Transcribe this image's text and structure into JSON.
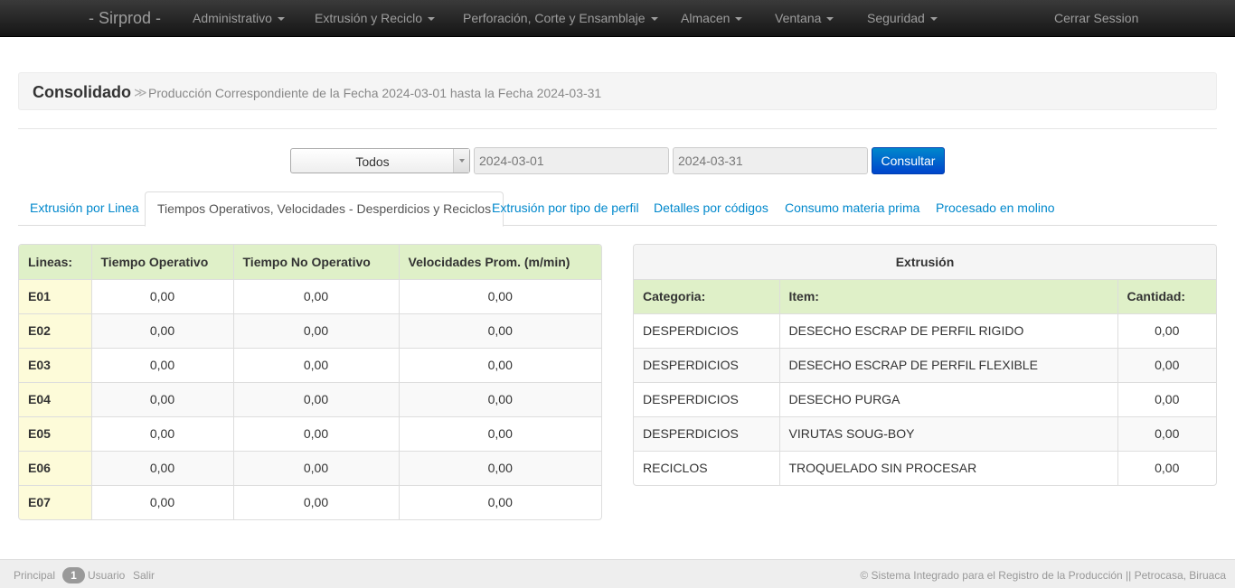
{
  "navbar": {
    "brand": "- Sirprod -",
    "menus": [
      "Administrativo",
      "Extrusión y Reciclo",
      "Perforación, Corte y Ensamblaje",
      "Almacen",
      "Ventana",
      "Seguridad"
    ],
    "logout": "Cerrar Session"
  },
  "breadcrumb": {
    "title": "Consolidado",
    "separator": "≫",
    "subtitle": "Producción Correspondiente de la Fecha 2024-03-01 hasta la Fecha 2024-03-31"
  },
  "filter": {
    "select_value": "Todos",
    "date_from": "2024-03-01",
    "date_to": "2024-03-31",
    "submit_label": "Consultar"
  },
  "tabs": [
    "Extrusión por Linea",
    "Tiempos Operativos, Velocidades - Desperdicios y Reciclos",
    "Extrusión por tipo de perfil",
    "Detalles por códigos",
    "Consumo materia prima",
    "Procesado en molino"
  ],
  "active_tab": 1,
  "lines_table": {
    "headers": [
      "Lineas:",
      "Tiempo Operativo",
      "Tiempo No Operativo",
      "Velocidades Prom. (m/min)"
    ],
    "rows": [
      [
        "E01",
        "0,00",
        "0,00",
        "0,00"
      ],
      [
        "E02",
        "0,00",
        "0,00",
        "0,00"
      ],
      [
        "E03",
        "0,00",
        "0,00",
        "0,00"
      ],
      [
        "E04",
        "0,00",
        "0,00",
        "0,00"
      ],
      [
        "E05",
        "0,00",
        "0,00",
        "0,00"
      ],
      [
        "E06",
        "0,00",
        "0,00",
        "0,00"
      ],
      [
        "E07",
        "0,00",
        "0,00",
        "0,00"
      ]
    ]
  },
  "extrusion_table": {
    "caption": "Extrusión",
    "headers": [
      "Categoria:",
      "Item:",
      "Cantidad:"
    ],
    "rows": [
      [
        "DESPERDICIOS",
        "DESECHO ESCRAP DE PERFIL RIGIDO",
        "0,00"
      ],
      [
        "DESPERDICIOS",
        "DESECHO ESCRAP DE PERFIL FLEXIBLE",
        "0,00"
      ],
      [
        "DESPERDICIOS",
        "DESECHO PURGA",
        "0,00"
      ],
      [
        "DESPERDICIOS",
        "VIRUTAS SOUG-BOY",
        "0,00"
      ],
      [
        "RECICLOS",
        "TROQUELADO SIN PROCESAR",
        "0,00"
      ]
    ]
  },
  "footer": {
    "home": "Principal",
    "badge": "1",
    "user": "Usuario",
    "exit": "Salir",
    "copyright": "© Sistema Integrado para el Registro de la Producción || Petrocasa, Biruaca"
  }
}
